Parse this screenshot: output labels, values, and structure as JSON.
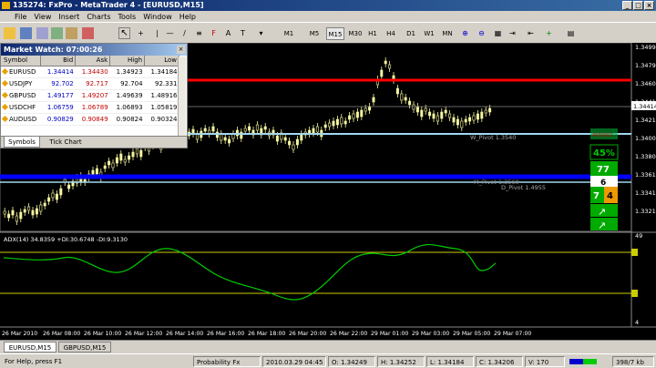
{
  "window": {
    "title": "135274: FxPro - MetaTrader 4 - [EURUSD,M15]"
  },
  "menu": [
    "File",
    "View",
    "Insert",
    "Charts",
    "Tools",
    "Window",
    "Help"
  ],
  "toolbar": {
    "timeframes": [
      "M1",
      "M5",
      "M15",
      "M30",
      "H1",
      "H4",
      "D1",
      "W1",
      "MN"
    ],
    "active_timeframe": "M15"
  },
  "market_watch": {
    "title": "Market Watch: 07:00:26",
    "columns": [
      "Symbol",
      "Bid",
      "Ask",
      "High",
      "Low"
    ],
    "rows": [
      {
        "symbol": "EURUSD",
        "bid": "1.34414",
        "ask": "1.34430",
        "high": "1.34923",
        "low": "1.34184"
      },
      {
        "symbol": "USDJPY",
        "bid": "92.702",
        "ask": "92.717",
        "high": "92.704",
        "low": "92.331"
      },
      {
        "symbol": "GBPUSD",
        "bid": "1.49177",
        "ask": "1.49207",
        "high": "1.49639",
        "low": "1.48916"
      },
      {
        "symbol": "USDCHF",
        "bid": "1.06759",
        "ask": "1.06789",
        "high": "1.06893",
        "low": "1.05819"
      },
      {
        "symbol": "AUDUSD",
        "bid": "0.90829",
        "ask": "0.90849",
        "high": "0.90824",
        "low": "0.90324"
      }
    ],
    "tabs": [
      "Symbols",
      "Tick Chart"
    ]
  },
  "chart": {
    "price_axis": [
      "1.34990",
      "1.34795",
      "1.34600",
      "1.34414",
      "1.34210",
      "1.34000",
      "1.33805",
      "1.33610",
      "1.33415",
      "1.33210"
    ],
    "current_price": "1.34414",
    "pivot_labels": [
      "W_Pivot 1.3540",
      "M_Pivot 1.3560",
      "D_Pivot 1.4955"
    ],
    "badge_label": "4000002",
    "widget": {
      "percent": "45%",
      "score": "77",
      "level": "6",
      "left_value": "7",
      "right_value": "4"
    },
    "indicator_label": "ADX(14) 34.8359 +DI:30.6748 -DI:9.3130",
    "indicator_axis": [
      "49",
      "4"
    ],
    "time_axis": [
      "26 Mar 2010",
      "26 Mar 08:00",
      "26 Mar 10:00",
      "26 Mar 12:00",
      "26 Mar 14:00",
      "26 Mar 16:00",
      "26 Mar 18:00",
      "26 Mar 20:00",
      "26 Mar 22:00",
      "29 Mar 01:00",
      "29 Mar 03:00",
      "29 Mar 05:00",
      "29 Mar 07:00"
    ],
    "colors": {
      "background": "#000000",
      "candles": "#f5f5a0",
      "resistance": "#ff0000",
      "support": "#0000ff",
      "pivot": "#a0d8ef",
      "adx": "#00cc00",
      "levels": "#cccc00"
    }
  },
  "chart_tabs": [
    "EURUSD,M15",
    "GBPUSD,M15"
  ],
  "status": {
    "help": "For Help, press F1",
    "profile": "Probability Fx",
    "datetime": "2010.03.29 04:45",
    "open": "O: 1.34249",
    "high": "H: 1.34252",
    "low": "L: 1.34184",
    "close": "C: 1.34206",
    "volume": "V: 170",
    "traffic": "398/7 kb"
  }
}
